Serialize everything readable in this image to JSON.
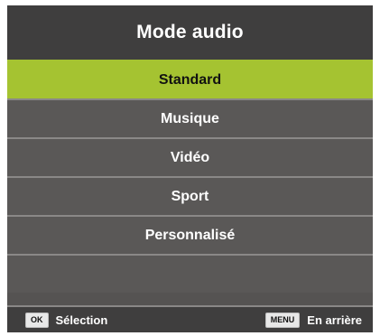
{
  "title": "Mode audio",
  "options": [
    {
      "label": "Standard",
      "selected": true
    },
    {
      "label": "Musique",
      "selected": false
    },
    {
      "label": "Vidéo",
      "selected": false
    },
    {
      "label": "Sport",
      "selected": false
    },
    {
      "label": "Personnalisé",
      "selected": false
    },
    {
      "label": "",
      "selected": false
    }
  ],
  "footer": {
    "ok_key": "OK",
    "ok_label": "Sélection",
    "menu_key": "MENU",
    "menu_label": "En arrière"
  },
  "colors": {
    "selected_bg": "#a5c331",
    "panel_bg": "#555352",
    "header_bg": "#3f3e3e"
  }
}
